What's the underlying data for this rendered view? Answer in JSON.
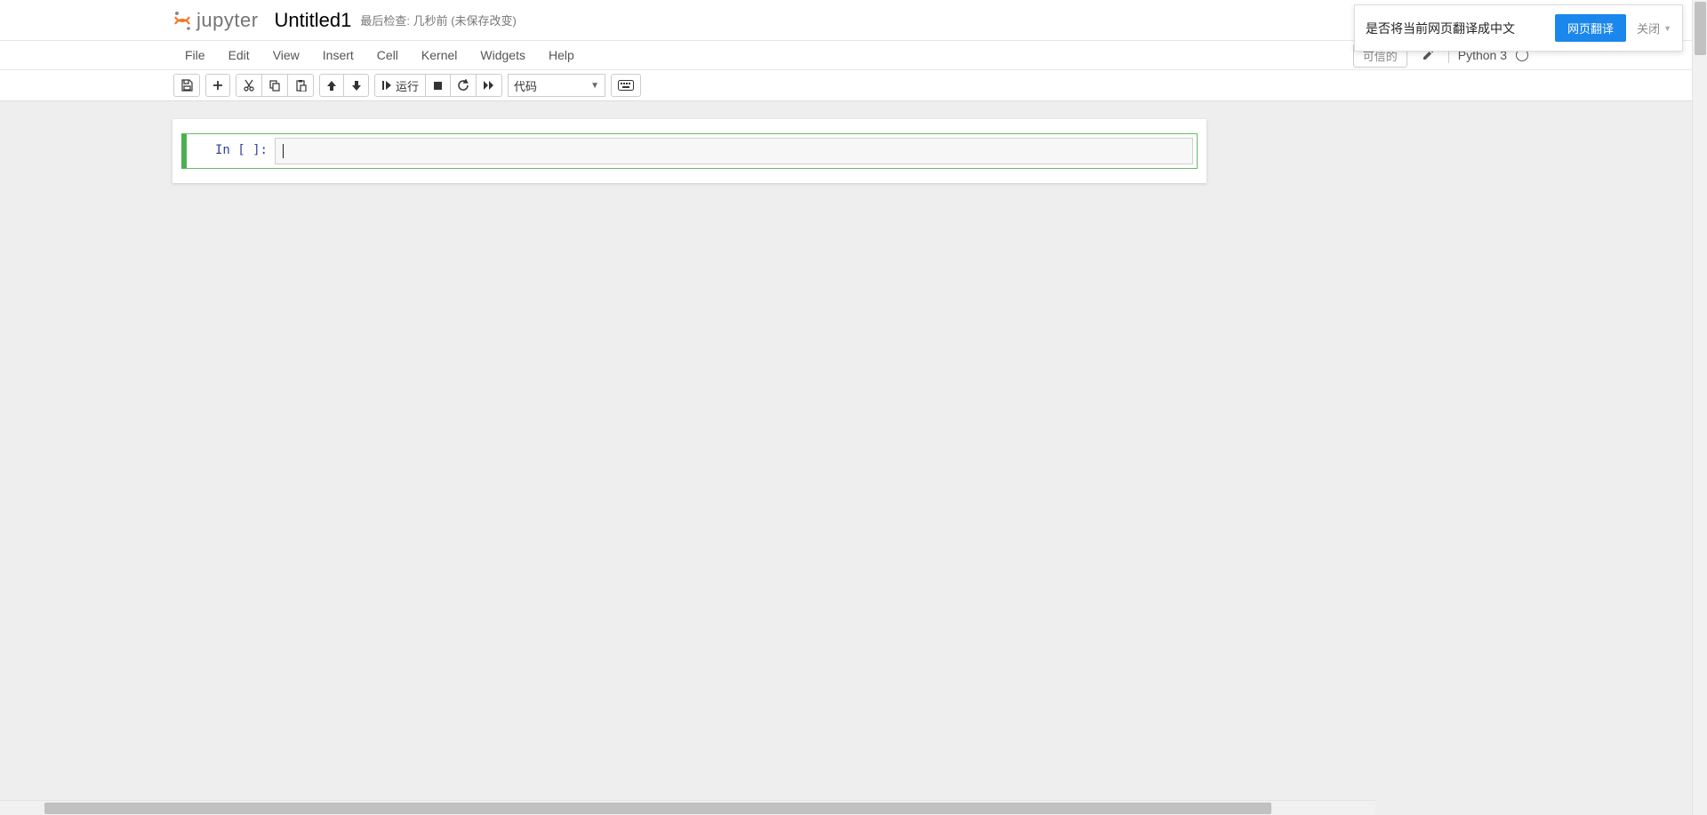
{
  "header": {
    "logo_text": "jupyter",
    "notebook_name": "Untitled1",
    "checkpoint": "最后检查: 几秒前  (未保存改变)"
  },
  "menus": [
    "File",
    "Edit",
    "View",
    "Insert",
    "Cell",
    "Kernel",
    "Widgets",
    "Help"
  ],
  "kernel": {
    "trusted": "可信的",
    "name": "Python 3"
  },
  "toolbar": {
    "run_label": "运行",
    "cell_type_selected": "代码"
  },
  "cell": {
    "prompt": "In  [  ]:",
    "content": ""
  },
  "translate_popup": {
    "text": "是否将当前网页翻译成中文",
    "translate_btn": "网页翻译",
    "close": "关闭"
  }
}
